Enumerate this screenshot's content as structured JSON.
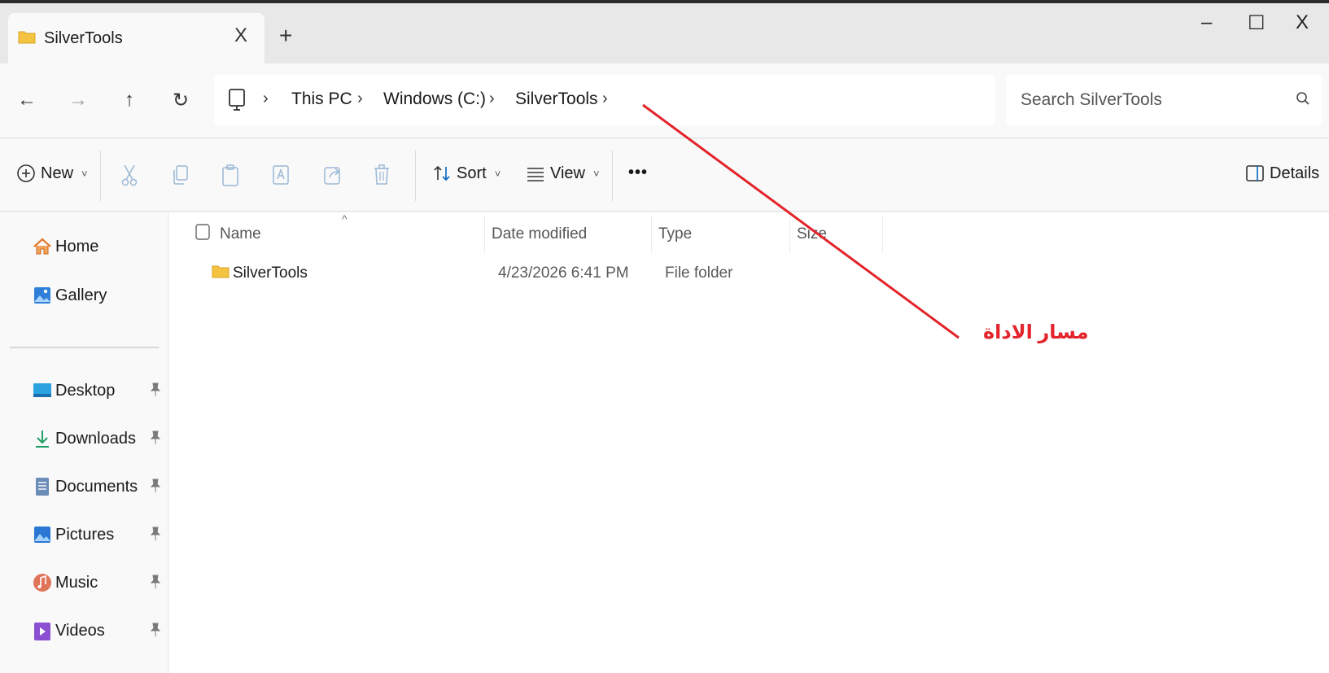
{
  "window": {
    "tab_title": "SilverTools",
    "tab_close": "X",
    "tab_add": "+",
    "minimize": "–",
    "maximize": "☐",
    "close": "X"
  },
  "nav": {
    "back": "←",
    "forward": "→",
    "up": "↑",
    "refresh": "↻"
  },
  "breadcrumb": {
    "items": [
      "This PC",
      "Windows (C:)",
      "SilverTools"
    ],
    "separator": "›"
  },
  "search": {
    "placeholder": "Search SilverTools"
  },
  "toolbar": {
    "new_label": "New",
    "sort_label": "Sort",
    "view_label": "View",
    "more_label": "•••",
    "details_label": "Details",
    "chevron": "˅"
  },
  "sidebar": {
    "top": [
      "Home",
      "Gallery"
    ],
    "pinned": [
      "Desktop",
      "Downloads",
      "Documents",
      "Pictures",
      "Music",
      "Videos"
    ]
  },
  "columns": {
    "name": "Name",
    "date": "Date modified",
    "type": "Type",
    "size": "Size",
    "sort_caret": "^"
  },
  "rows": [
    {
      "name": "SilverTools",
      "date": "4/23/2026 6:41 PM",
      "type": "File folder",
      "size": ""
    }
  ],
  "annotation": {
    "text": "مسار الاداة",
    "color": "#e3242b"
  },
  "colors": {
    "accent": "#0067c0",
    "folder": "#f5c342",
    "annotation": "#e3242b"
  }
}
